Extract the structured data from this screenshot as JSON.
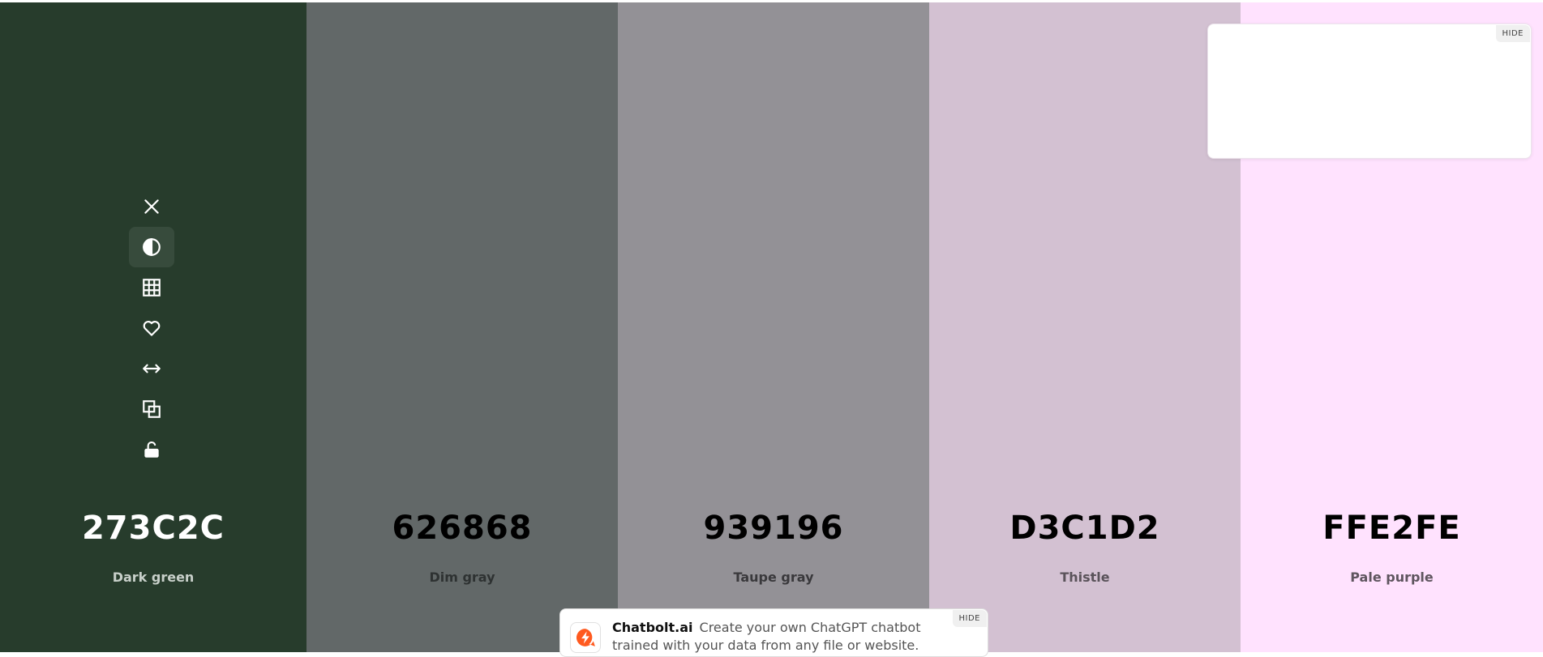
{
  "palette": [
    {
      "hex": "273C2C",
      "name": "Dark green",
      "color": "#273C2C",
      "text_color": "#ffffff",
      "name_color": "#c8d0ca"
    },
    {
      "hex": "626868",
      "name": "Dim gray",
      "color": "#626868",
      "text_color": "#000000",
      "name_color": "#2e3232"
    },
    {
      "hex": "939196",
      "name": "Taupe gray",
      "color": "#939196",
      "text_color": "#000000",
      "name_color": "#3a393c"
    },
    {
      "hex": "D3C1D2",
      "name": "Thistle",
      "color": "#D3C1D2",
      "text_color": "#000000",
      "name_color": "#5a535a"
    },
    {
      "hex": "FFE2FE",
      "name": "Pale purple",
      "color": "#FFE2FE",
      "text_color": "#000000",
      "name_color": "#5f555f"
    }
  ],
  "toolbar": {
    "items": [
      {
        "icon": "close-icon"
      },
      {
        "icon": "contrast-icon"
      },
      {
        "icon": "grid-icon"
      },
      {
        "icon": "heart-icon"
      },
      {
        "icon": "drag-arrows-icon"
      },
      {
        "icon": "copy-icon"
      },
      {
        "icon": "unlock-icon"
      }
    ]
  },
  "ad_box": {
    "hide_label": "HIDE"
  },
  "banner": {
    "brand": "Chatbolt.ai",
    "text": "Create your own ChatGPT chatbot trained with your data from any file or website.",
    "hide_label": "HIDE",
    "logo_color": "#ff5a1f"
  }
}
